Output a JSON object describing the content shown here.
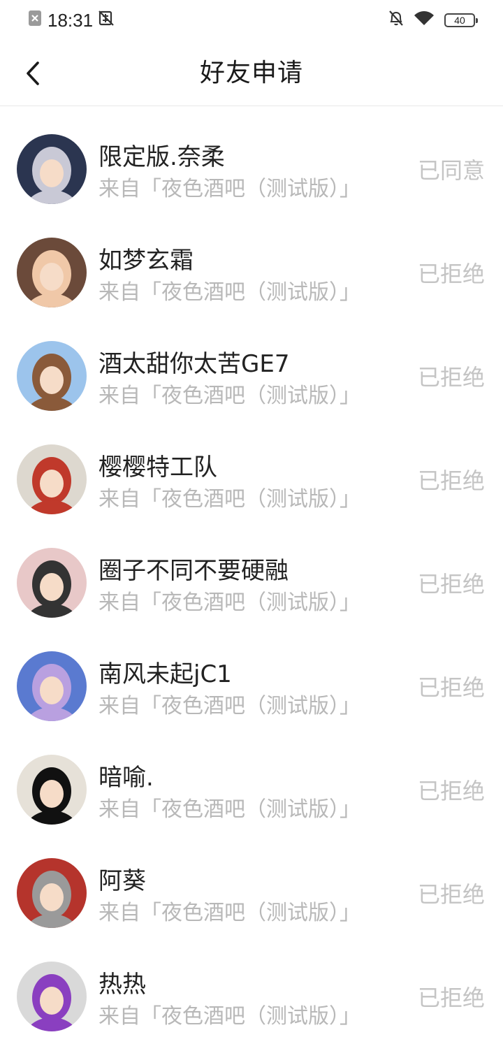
{
  "status_bar": {
    "time": "18:31",
    "battery": "40",
    "icons": [
      "notification-x-icon",
      "silent-icon",
      "bell-off-icon",
      "wifi-icon",
      "battery-icon"
    ]
  },
  "header": {
    "title": "好友申请",
    "back_icon": "chevron-left-icon"
  },
  "requests": [
    {
      "name": "限定版.奈柔",
      "source": "来自「夜色酒吧（测试版）」",
      "status": "已同意",
      "avatar_color": "#2b3550",
      "avatar_accent": "#c9c9d6"
    },
    {
      "name": "如梦玄霜",
      "source": "来自「夜色酒吧（测试版）」",
      "status": "已拒绝",
      "avatar_color": "#6b4a3a",
      "avatar_accent": "#f0c8a8"
    },
    {
      "name": "酒太甜你太苦GE7",
      "source": "来自「夜色酒吧（测试版）」",
      "status": "已拒绝",
      "avatar_color": "#9cc4ec",
      "avatar_accent": "#8a5a3a"
    },
    {
      "name": "樱樱特工队",
      "source": "来自「夜色酒吧（测试版）」",
      "status": "已拒绝",
      "avatar_color": "#ddd8cf",
      "avatar_accent": "#c0392b"
    },
    {
      "name": "圈子不同不要硬融",
      "source": "来自「夜色酒吧（测试版）」",
      "status": "已拒绝",
      "avatar_color": "#e8c8c8",
      "avatar_accent": "#333333"
    },
    {
      "name": "南风未起jC1",
      "source": "来自「夜色酒吧（测试版）」",
      "status": "已拒绝",
      "avatar_color": "#5a7ad0",
      "avatar_accent": "#b9a0e0"
    },
    {
      "name": "暗喻.",
      "source": "来自「夜色酒吧（测试版）」",
      "status": "已拒绝",
      "avatar_color": "#e6e1d8",
      "avatar_accent": "#111111"
    },
    {
      "name": "阿葵",
      "source": "来自「夜色酒吧（测试版）」",
      "status": "已拒绝",
      "avatar_color": "#b5342c",
      "avatar_accent": "#9a9a9a"
    },
    {
      "name": "热热",
      "source": "来自「夜色酒吧（测试版）」",
      "status": "已拒绝",
      "avatar_color": "#d9d9d9",
      "avatar_accent": "#8a3fc0"
    }
  ]
}
